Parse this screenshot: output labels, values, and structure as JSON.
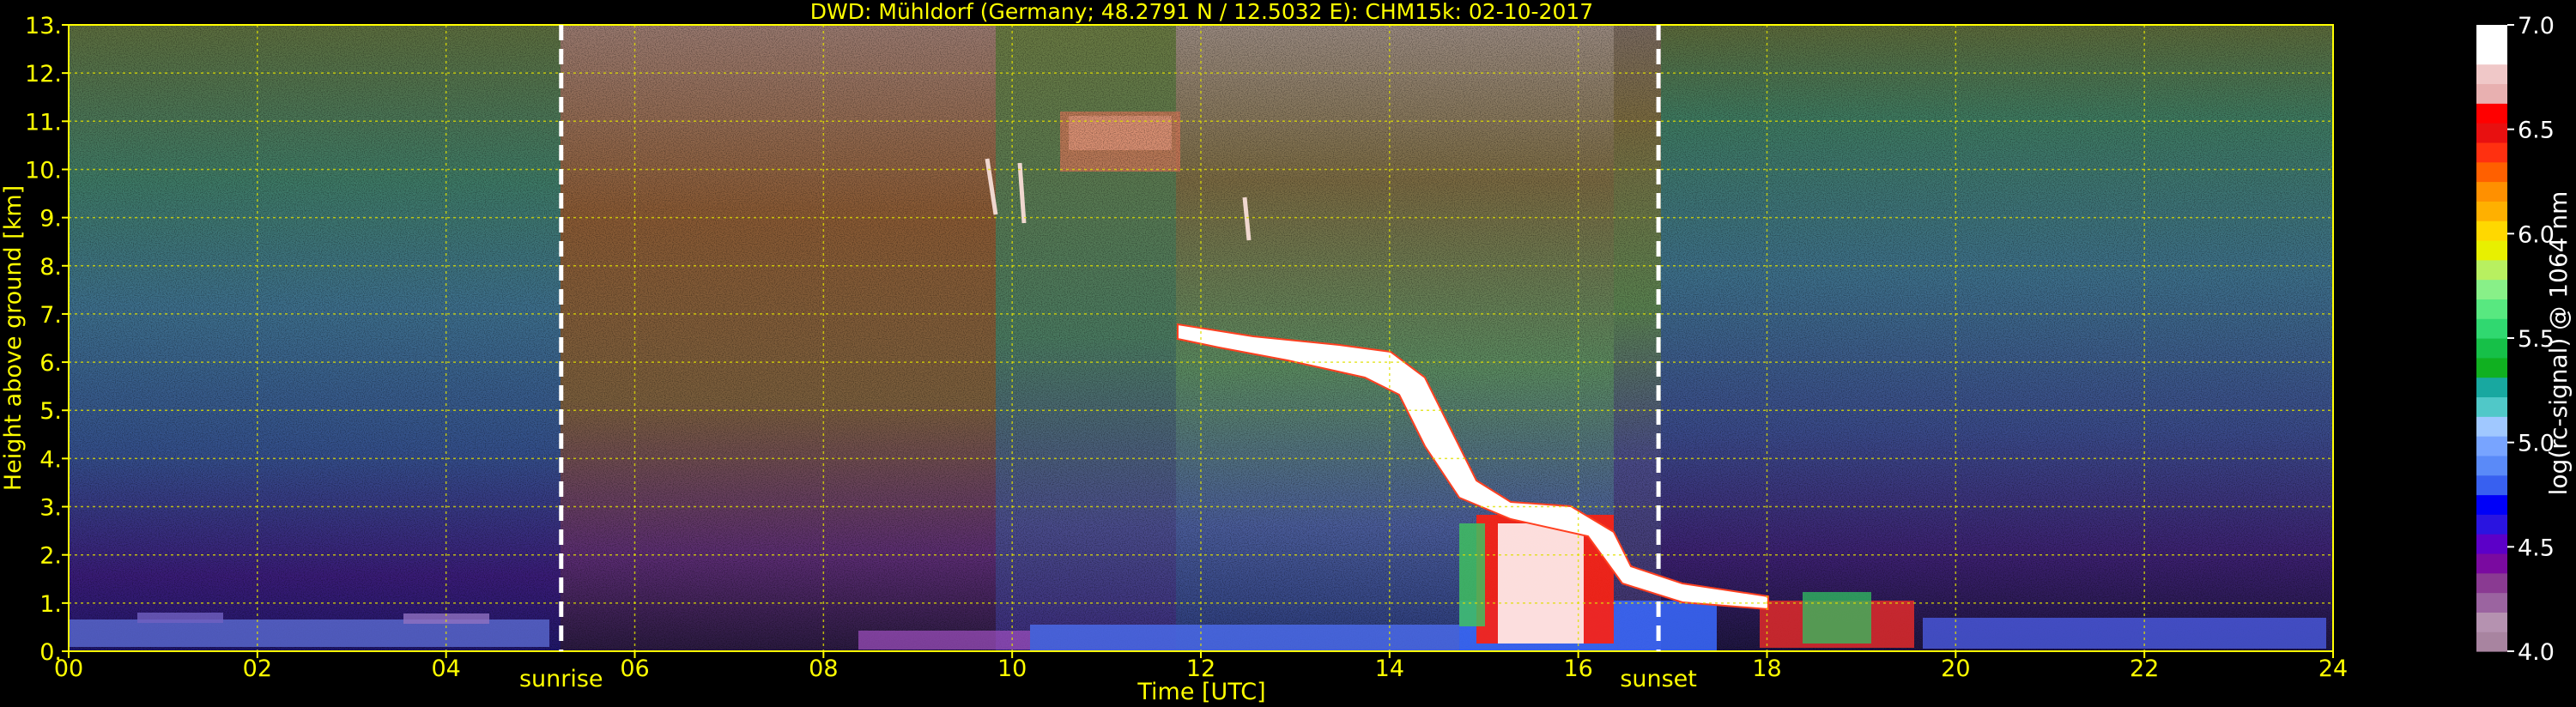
{
  "chart_data": {
    "type": "heatmap",
    "title": "DWD: Mühldorf (Germany; 48.2791 N / 12.5032 E):    CHM15k: 02-10-2017",
    "xlabel": "Time [UTC]",
    "ylabel": "Height above ground [km]",
    "xlim": [
      0,
      24
    ],
    "ylim": [
      0,
      13
    ],
    "x_ticks": [
      0,
      2,
      4,
      6,
      8,
      10,
      12,
      14,
      16,
      18,
      20,
      22,
      24
    ],
    "x_tick_labels": [
      "00",
      "02",
      "04",
      "06",
      "08",
      "10",
      "12",
      "14",
      "16",
      "18",
      "20",
      "22",
      "24"
    ],
    "y_ticks": [
      0,
      1,
      2,
      3,
      4,
      5,
      6,
      7,
      8,
      9,
      10,
      11,
      12,
      13
    ],
    "y_tick_labels": [
      "0.",
      "1.",
      "2.",
      "3.",
      "4.",
      "5.",
      "6.",
      "7.",
      "8.",
      "9.",
      "10.",
      "11.",
      "12.",
      "13."
    ],
    "grid": true,
    "markers": [
      {
        "label": "sunrise",
        "x": 5.22
      },
      {
        "label": "sunset",
        "x": 16.85
      }
    ],
    "colorbar": {
      "label": "log(rc-signal) @ 1064 nm",
      "range": [
        4.0,
        7.0
      ],
      "ticks": [
        4.0,
        4.5,
        5.0,
        5.5,
        6.0,
        6.5,
        7.0
      ],
      "tick_labels": [
        "4.0",
        "4.5",
        "5.0",
        "5.5",
        "6.0",
        "6.5",
        "7.0"
      ],
      "colors": [
        "#a884a0",
        "#b592b0",
        "#9b64a0",
        "#8a3a92",
        "#7a0aa0",
        "#5c00c8",
        "#2a14e0",
        "#0000f8",
        "#3860f0",
        "#5a8af8",
        "#78a4ff",
        "#a0c8ff",
        "#50c8c8",
        "#18a8a0",
        "#10b020",
        "#16c048",
        "#30d870",
        "#58e880",
        "#88f088",
        "#b8f060",
        "#e8f000",
        "#ffd800",
        "#ffb000",
        "#ff9000",
        "#ff6000",
        "#ff3010",
        "#e81010",
        "#ff0000",
        "#e8b0b0",
        "#f0c8c8",
        "#ffffff",
        "#ffffff"
      ]
    }
  }
}
